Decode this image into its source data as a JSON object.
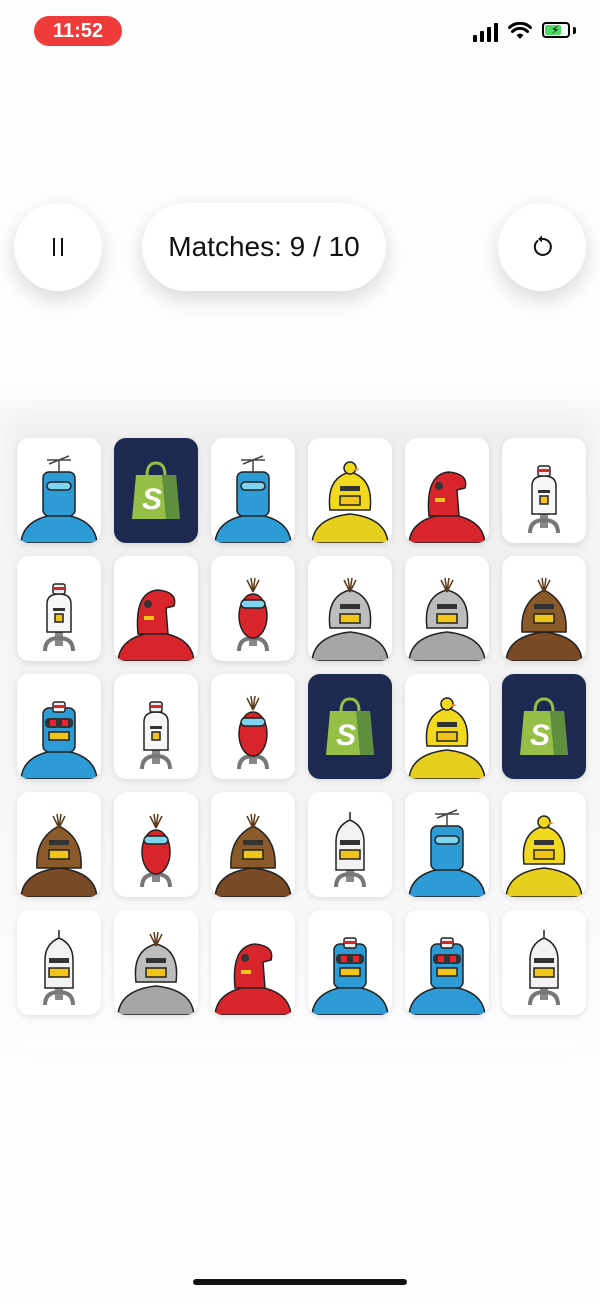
{
  "status_bar": {
    "time": "11:52"
  },
  "hud": {
    "score_text": "Matches: 9 / 10"
  },
  "colors": {
    "card_back": "#1e2951",
    "bag_green": "#95bf47",
    "time_pill": "#ef3c3a"
  },
  "board": {
    "rows": [
      [
        {
          "face": "up",
          "robot": "blue-antenna"
        },
        {
          "face": "down"
        },
        {
          "face": "up",
          "robot": "blue-antenna"
        },
        {
          "face": "up",
          "robot": "yellow-duck"
        },
        {
          "face": "up",
          "robot": "red-hood"
        },
        {
          "face": "up",
          "robot": "white-cap"
        }
      ],
      [
        {
          "face": "up",
          "robot": "white-cap"
        },
        {
          "face": "up",
          "robot": "red-hood"
        },
        {
          "face": "up",
          "robot": "red-sprout"
        },
        {
          "face": "up",
          "robot": "grey-round"
        },
        {
          "face": "up",
          "robot": "grey-round"
        },
        {
          "face": "up",
          "robot": "brown-onion"
        }
      ],
      [
        {
          "face": "up",
          "robot": "blue-visor"
        },
        {
          "face": "up",
          "robot": "white-cap"
        },
        {
          "face": "up",
          "robot": "red-sprout"
        },
        {
          "face": "down"
        },
        {
          "face": "up",
          "robot": "yellow-duck"
        },
        {
          "face": "down"
        }
      ],
      [
        {
          "face": "up",
          "robot": "brown-onion"
        },
        {
          "face": "up",
          "robot": "red-sprout"
        },
        {
          "face": "up",
          "robot": "brown-onion"
        },
        {
          "face": "up",
          "robot": "white-spike"
        },
        {
          "face": "up",
          "robot": "blue-antenna"
        },
        {
          "face": "up",
          "robot": "yellow-duck"
        }
      ],
      [
        {
          "face": "up",
          "robot": "white-spike"
        },
        {
          "face": "up",
          "robot": "grey-round"
        },
        {
          "face": "up",
          "robot": "red-hood"
        },
        {
          "face": "up",
          "robot": "blue-visor"
        },
        {
          "face": "up",
          "robot": "blue-visor"
        },
        {
          "face": "up",
          "robot": "white-spike"
        }
      ]
    ]
  }
}
